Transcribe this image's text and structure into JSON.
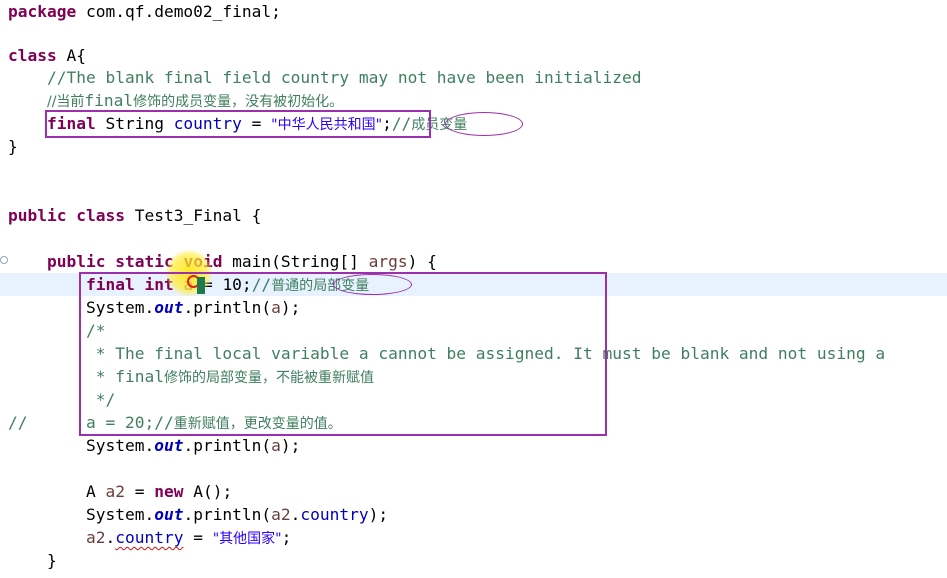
{
  "code": {
    "l1": {
      "kw": "package",
      "rest": " com.qf.demo02_final;"
    },
    "l2": {
      "kw": "class",
      "rest": " A{"
    },
    "l3": {
      "indent": "    ",
      "comment": "//The blank final field country may not have been initialized"
    },
    "l4": {
      "indent": "    ",
      "prefix": "//当前",
      "final_word": "final",
      "suffix": "修饰的成员变量，没有被初始化。"
    },
    "l5": {
      "indent": "    ",
      "kw": "final",
      "type": " String ",
      "field": "country",
      "eq": " = ",
      "str": "\"中华人民共和国\"",
      "semi": ";",
      "comment_prefix": "//",
      "comment_cjk": "成员变量"
    },
    "l6": {
      "text": "}"
    },
    "l7": {
      "kw1": "public",
      "kw2": "class",
      "rest": " Test3_Final {"
    },
    "l8": {
      "indent": "    ",
      "kw1": "public",
      "kw2": "static",
      "kw3": "void",
      "rest1": " main(String[] ",
      "param": "args",
      "rest2": ") {"
    },
    "l9": {
      "indent": "        ",
      "kw1": "final",
      "kw2": "int",
      "var": "a",
      "rest": " = 10;",
      "comment_prefix": "//",
      "comment_cjk_a": "普通的",
      "comment_cjk_b": "局部变量"
    },
    "l10": {
      "indent": "        ",
      "pre": "System.",
      "sfield": "out",
      "mid": ".println(",
      "var": "a",
      "post": ");"
    },
    "l11": {
      "indent": "        ",
      "comment": "/*"
    },
    "l12": {
      "indent": "        ",
      "comment": " * The final local variable a cannot be assigned. It must be blank and not using a"
    },
    "l13": {
      "indent": "        ",
      "comment_a": " * ",
      "final_word": "final",
      "comment_cjk": "修饰的局部变量，不能被重新赋值"
    },
    "l14": {
      "indent": "        ",
      "comment": " */"
    },
    "l15": {
      "slashes": "//",
      "gap": "      ",
      "code": "a = 20;",
      "comment_prefix": "//",
      "comment_cjk": "重新赋值，更改变量的值。"
    },
    "l16": {
      "indent": "        ",
      "pre": "System.",
      "sfield": "out",
      "mid": ".println(",
      "var": "a",
      "post": ");"
    },
    "l17": {
      "indent": "        ",
      "type": "A ",
      "var": "a2",
      "eq": " = ",
      "kw": "new",
      "rest": " A();"
    },
    "l18": {
      "indent": "        ",
      "pre": "System.",
      "sfield": "out",
      "mid": ".println(",
      "var": "a2",
      "dot": ".",
      "field": "country",
      "post": ");"
    },
    "l19": {
      "indent": "        ",
      "var": "a2",
      "dot": ".",
      "field": "country",
      "eq": " = ",
      "str": "\"其他国家\"",
      "semi": ";"
    },
    "l20": {
      "indent": "    ",
      "text": "}"
    }
  },
  "colors": {
    "keyword": "#7f0055",
    "comment": "#3f7f5f",
    "string": "#2a00ff",
    "field": "#0000c0",
    "local_variable": "#6a3e3e",
    "annotation_pen": "#9b2fae",
    "current_line": "#e8f2fe",
    "cursor_highlight": "#ffe600"
  }
}
